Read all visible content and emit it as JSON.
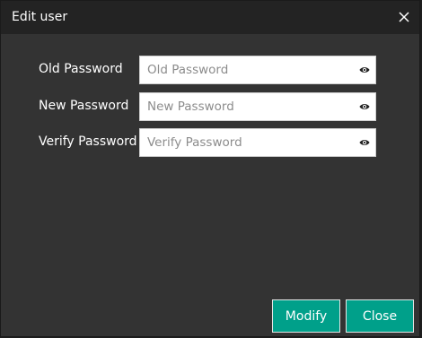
{
  "dialog": {
    "title": "Edit user"
  },
  "fields": [
    {
      "label": "Old Password",
      "placeholder": "Old Password",
      "value": ""
    },
    {
      "label": "New Password",
      "placeholder": "New Password",
      "value": ""
    },
    {
      "label": "Verify Password",
      "placeholder": "Verify Password",
      "value": ""
    }
  ],
  "buttons": {
    "modify_label": "Modify",
    "close_label": "Close"
  },
  "colors": {
    "accent": "#00a08a",
    "dialog_bg": "#333333",
    "titlebar_bg": "#232323"
  },
  "icons": {
    "close": "close-icon",
    "eye": "eye-icon"
  }
}
